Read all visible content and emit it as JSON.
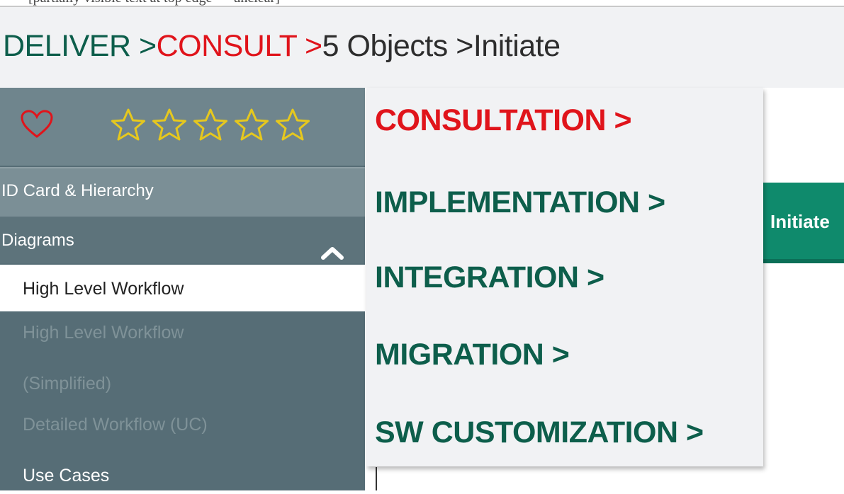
{
  "top_strip": {
    "text": "[partially visible text at top edge — unclear]"
  },
  "breadcrumb": {
    "deliver": "DELIVER >",
    "consult": "CONSULT >",
    "objects": "5 Objects >",
    "initiate": "Initiate"
  },
  "rating": {
    "favorite_icon": "heart-icon",
    "stars_filled": 0,
    "stars_total": 5
  },
  "sidebar": {
    "id_card": "ID Card & Hierarchy",
    "diagrams": "Diagrams",
    "high_level_workflow": "High Level Workflow",
    "high_level_workflow_simplified_1": "High Level Workflow",
    "high_level_workflow_simplified_2": "(Simplified)",
    "detailed_workflow": "Detailed Workflow (UC)",
    "use_cases": "Use Cases"
  },
  "menu": {
    "items": [
      {
        "label": "CONSULTATION >",
        "active": true
      },
      {
        "label": "IMPLEMENTATION >",
        "active": false
      },
      {
        "label": "INTEGRATION >",
        "active": false
      },
      {
        "label": "MIGRATION >",
        "active": false
      },
      {
        "label": "SW CUSTOMIZATION >",
        "active": false
      }
    ]
  },
  "initiate_button": {
    "label": "Initiate"
  },
  "colors": {
    "brand_green": "#0d5e4b",
    "accent_red": "#e0141b",
    "sidebar": "#566d76",
    "button_green": "#0f8a6c",
    "star_yellow": "#e6c81e"
  }
}
